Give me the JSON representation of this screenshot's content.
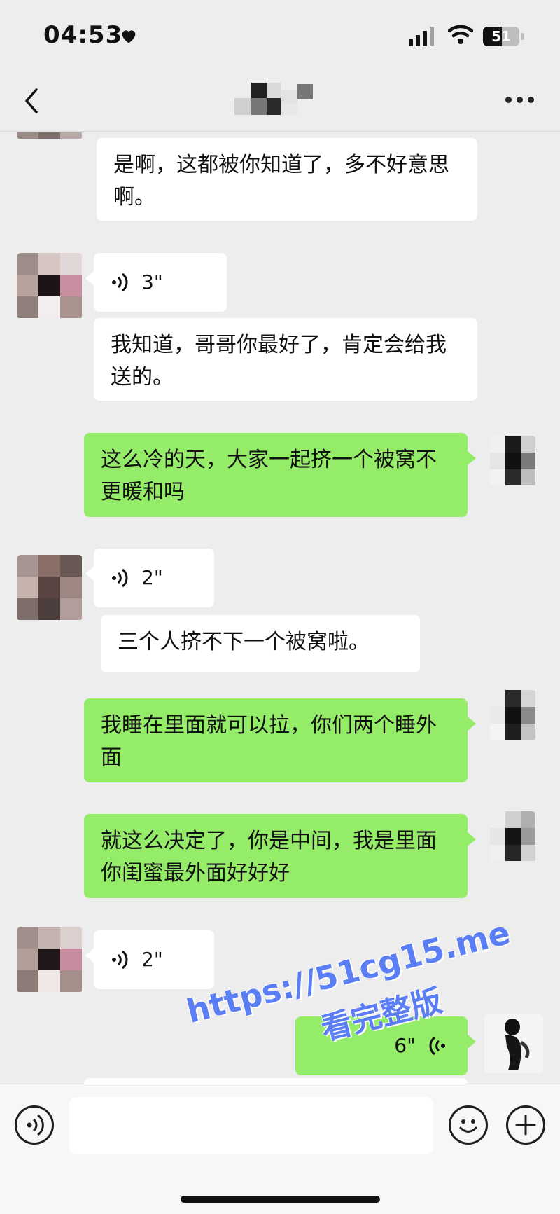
{
  "status_bar": {
    "time": "04:53",
    "battery": "51",
    "battery_level": 0.51
  },
  "header": {
    "title_redacted": true
  },
  "messages": [
    {
      "side": "in",
      "type": "text",
      "text": "是啊，这都被你知道了，多不好意思啊。"
    },
    {
      "side": "in",
      "type": "voice",
      "duration": "3\""
    },
    {
      "side": "in",
      "type": "text",
      "text": "我知道，哥哥你最好了，肯定会给我送的。"
    },
    {
      "side": "out",
      "type": "text",
      "text": "这么冷的天，大家一起挤一个被窝不更暖和吗"
    },
    {
      "side": "in",
      "type": "voice",
      "duration": "2\""
    },
    {
      "side": "in",
      "type": "text",
      "text": "三个人挤不下一个被窝啦。"
    },
    {
      "side": "out",
      "type": "text",
      "text": "我睡在里面就可以拉，你们两个睡外面"
    },
    {
      "side": "out",
      "type": "text",
      "text": "就这么决定了，你是中间，我是里面你闺蜜最外面好好好"
    },
    {
      "side": "in",
      "type": "voice",
      "duration": "2\""
    },
    {
      "side": "out",
      "type": "voice",
      "duration": "6\""
    }
  ],
  "input_bar": {
    "voice_button_icon": "voice-icon",
    "emoji_button_icon": "emoji-icon",
    "plus_button_icon": "plus-icon"
  },
  "watermark": {
    "url": "https://51cg15.me",
    "text": "看完整版",
    "color": "#5b7ef5"
  },
  "colors": {
    "background": "#ededed",
    "incoming_bubble": "#ffffff",
    "outgoing_bubble": "#95ec69"
  }
}
